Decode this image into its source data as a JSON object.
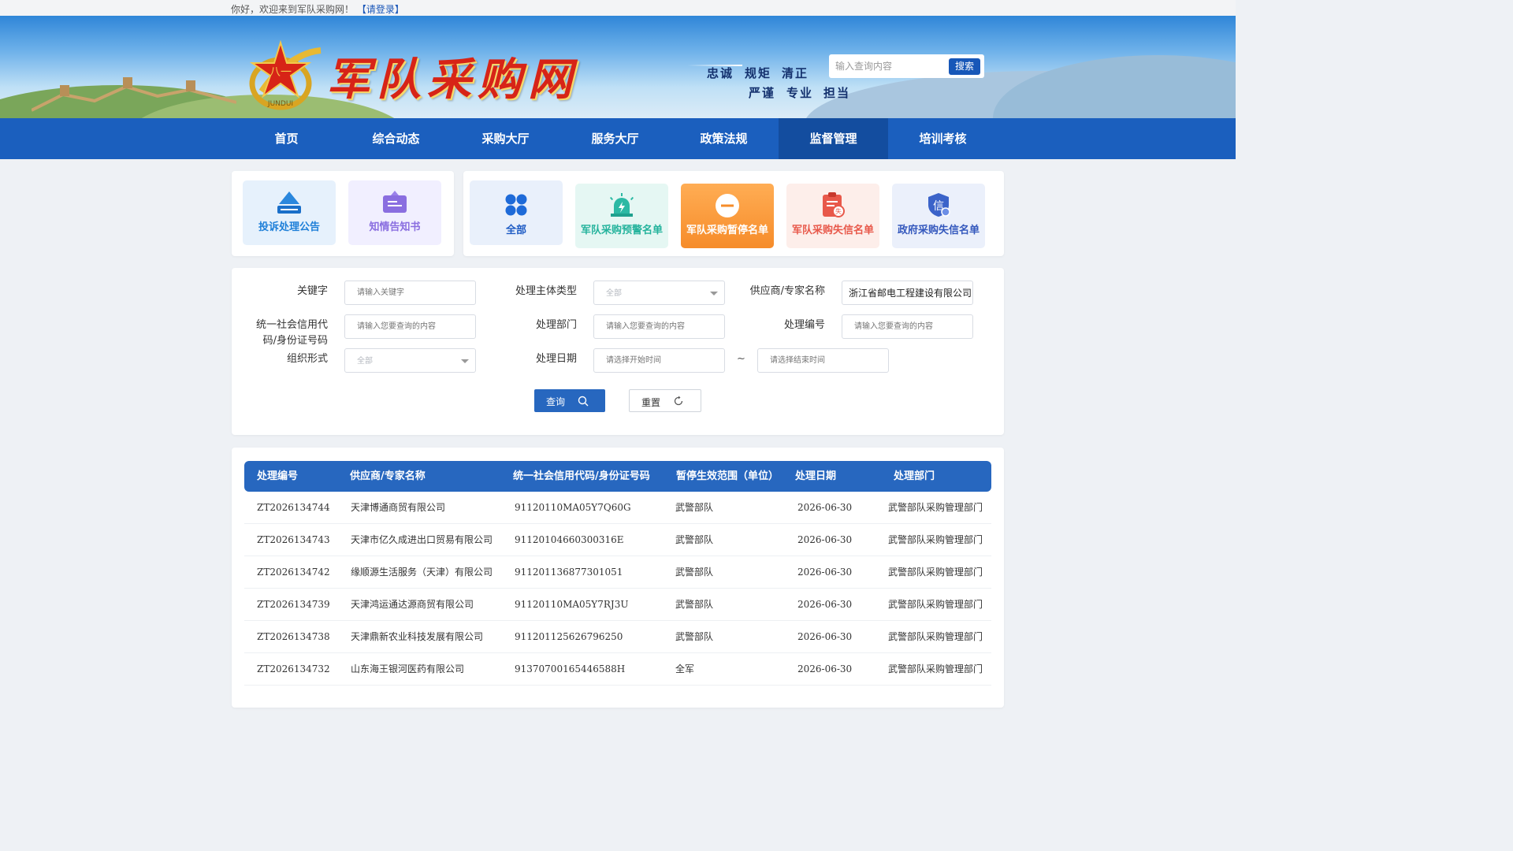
{
  "topbar": {
    "greeting": "你好，欢迎来到军队采购网！",
    "login_link": "【请登录】"
  },
  "header": {
    "logo_title": "军队采购网",
    "emblem_text": "JUNDUI",
    "motto_row1": [
      "忠诚",
      "规矩",
      "清正"
    ],
    "motto_row2": [
      "严谨",
      "专业",
      "担当"
    ],
    "search_placeholder": "输入查询内容",
    "search_button": "搜索"
  },
  "nav": {
    "items": [
      {
        "label": "首页"
      },
      {
        "label": "综合动态"
      },
      {
        "label": "采购大厅"
      },
      {
        "label": "服务大厅"
      },
      {
        "label": "政策法规"
      },
      {
        "label": "监督管理"
      },
      {
        "label": "培训考核"
      }
    ],
    "active": "监督管理"
  },
  "quick_links": {
    "left": [
      {
        "label": "投诉处理公告",
        "icon": "inbox-arrow-icon",
        "color": "#1e7fd8"
      },
      {
        "label": "知情告知书",
        "icon": "notice-board-icon",
        "color": "#8a6ee0"
      }
    ],
    "right": [
      {
        "label": "全部",
        "icon": "grid-four-icon",
        "color": "#1e6ad8"
      },
      {
        "label": "军队采购预警名单",
        "icon": "alarm-light-icon",
        "color": "#2cb9a4"
      },
      {
        "label": "军队采购暂停名单",
        "icon": "minus-circle-icon",
        "color": "#ffffff"
      },
      {
        "label": "军队采购失信名单",
        "icon": "clipboard-seal-icon",
        "color": "#e8584a"
      },
      {
        "label": "政府采购失信名单",
        "icon": "shield-credit-icon",
        "color": "#3b63c9"
      }
    ]
  },
  "filters": {
    "keyword_label": "关键字",
    "keyword_placeholder": "请输入关键字",
    "subject_type_label": "处理主体类型",
    "subject_type_value": "全部",
    "supplier_label": "供应商/专家名称",
    "supplier_value": "浙江省邮电工程建设有限公司",
    "credit_code_label": "统一社会信用代码/身份证号码",
    "credit_code_placeholder": "请输入您要查询的内容",
    "dept_label": "处理部门",
    "dept_placeholder": "请输入您要查询的内容",
    "number_label": "处理编号",
    "number_placeholder": "请输入您要查询的内容",
    "org_form_label": "组织形式",
    "org_form_value": "全部",
    "date_label": "处理日期",
    "date_start_placeholder": "请选择开始时间",
    "date_sep": "~",
    "date_end_placeholder": "请选择结束时间",
    "query_button": "查询",
    "reset_button": "重置"
  },
  "table": {
    "columns": [
      "处理编号",
      "供应商/专家名称",
      "统一社会信用代码/身份证号码",
      "暂停生效范围（单位）",
      "处理日期",
      "处理部门"
    ],
    "rows": [
      [
        "ZT2026134744",
        "天津博通商贸有限公司",
        "91120110MA05Y7Q60G",
        "武警部队",
        "2026-06-30",
        "武警部队采购管理部门"
      ],
      [
        "ZT2026134743",
        "天津市亿久成进出口贸易有限公司",
        "91120104660300316E",
        "武警部队",
        "2026-06-30",
        "武警部队采购管理部门"
      ],
      [
        "ZT2026134742",
        "缘顺源生活服务（天津）有限公司",
        "911201136877301051",
        "武警部队",
        "2026-06-30",
        "武警部队采购管理部门"
      ],
      [
        "ZT2026134739",
        "天津鸿运通达源商贸有限公司",
        "91120110MA05Y7RJ3U",
        "武警部队",
        "2026-06-30",
        "武警部队采购管理部门"
      ],
      [
        "ZT2026134738",
        "天津鼎新农业科技发展有限公司",
        "911201125626796250",
        "武警部队",
        "2026-06-30",
        "武警部队采购管理部门"
      ],
      [
        "ZT2026134732",
        "山东海王银河医药有限公司",
        "91370700165446588H",
        "全军",
        "2026-06-30",
        "武警部队采购管理部门"
      ]
    ]
  }
}
